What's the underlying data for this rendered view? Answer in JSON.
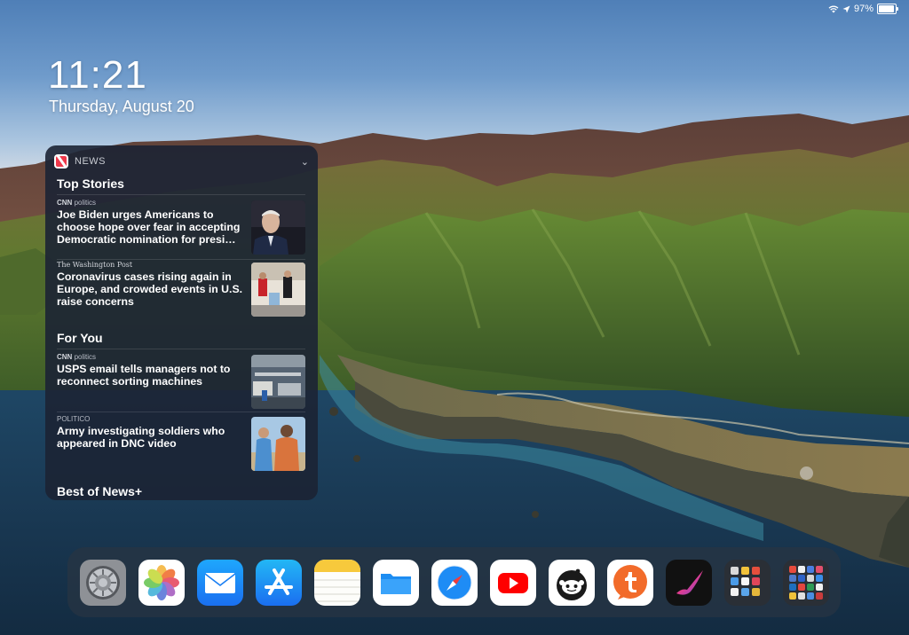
{
  "status_bar": {
    "battery": "97%",
    "battery_level": 0.97
  },
  "lock": {
    "time": "11:21",
    "date": "Thursday, August 20"
  },
  "widget": {
    "app_name": "NEWS",
    "sections": {
      "top_stories": "Top Stories",
      "for_you": "For You",
      "best_of": "Best of News+"
    },
    "stories": [
      {
        "source": "CNN",
        "source_tag": "politics",
        "headline": "Joe Biden urges Americans to choose hope over fear in accepting Democratic nomination for presi…"
      },
      {
        "source": "The Washington Post",
        "source_tag": "",
        "headline": "Coronavirus cases rising again in Europe, and crowded events in U.S. raise concerns"
      },
      {
        "source": "CNN",
        "source_tag": "politics",
        "headline": "USPS email tells managers not to reconnect sorting machines"
      },
      {
        "source": "POLITICO",
        "source_tag": "",
        "headline": "Army investigating soldiers who appeared in DNC video"
      }
    ]
  },
  "dock": {
    "apps": [
      "settings-app",
      "photos-app",
      "mail-app",
      "app-store-app",
      "notes-app",
      "files-app",
      "safari-app",
      "youtube-app",
      "apollo-reddit-app",
      "tumbleweed-app",
      "procreate-app",
      "folder-1",
      "folder-2"
    ]
  },
  "colors": {
    "news_red": "#f0394b",
    "widget_bg": "#1c2434"
  }
}
